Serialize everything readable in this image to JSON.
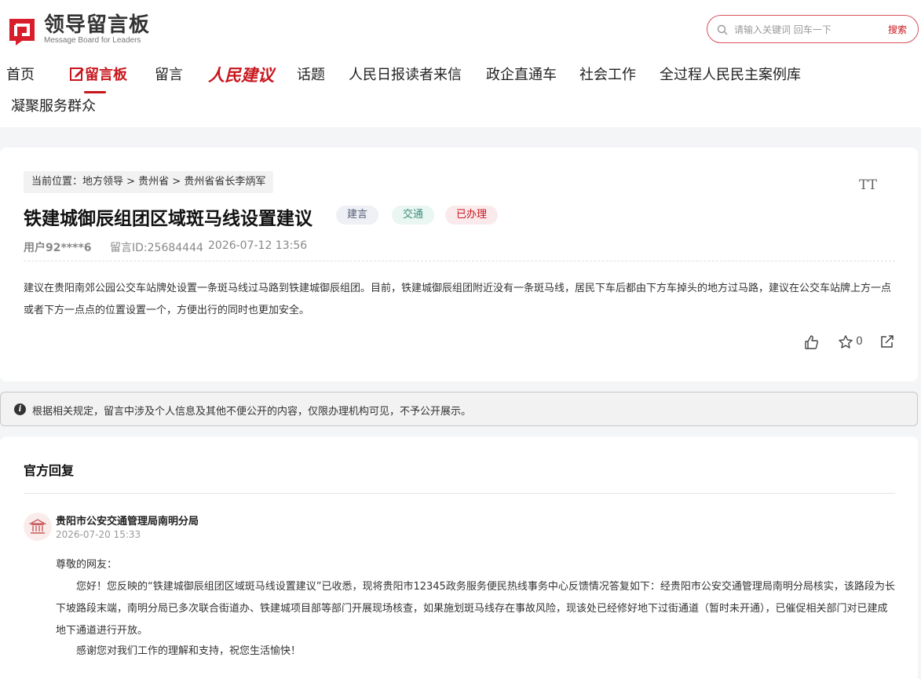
{
  "header": {
    "logo_cn": "领导留言板",
    "logo_en": "Message Board for Leaders",
    "search_placeholder": "请输入关键词 回车一下",
    "search_button": "搜索",
    "brand_color": "#c8161d"
  },
  "nav": {
    "home": "首页",
    "board": "留言板",
    "message": "留言",
    "peoples_suggestion": "人民建议",
    "topics": "话题",
    "letters": "人民日报读者来信",
    "business": "政企直通车",
    "social": "社会工作",
    "democracy": "全过程人民民主案例库",
    "serve": "凝聚服务群众"
  },
  "post": {
    "breadcrumb": "当前位置：地方领导 > 贵州省 > 贵州省省长李炳军",
    "font_toggle": "TT",
    "title": "铁建城御辰组团区域斑马线设置建议",
    "tags": [
      "建言",
      "交通",
      "已办理"
    ],
    "user": "用户92****6",
    "message_id": "留言ID:25684444",
    "time": "2026-07-12 13:56",
    "body": "建议在贵阳南郊公园公交车站牌处设置一条斑马线过马路到铁建城御辰组团。目前，铁建城御辰组团附近没有一条斑马线，居民下车后都由下方车掉头的地方过马路，建议在公交车站牌上方一点或者下方一点点的位置设置一个，方便出行的同时也更加安全。",
    "favorite_count": "0"
  },
  "notice": {
    "text": "根据相关规定，留言中涉及个人信息及其他不便公开的内容，仅限办理机构可见，不予公开展示。"
  },
  "reply": {
    "heading": "官方回复",
    "org": "贵阳市公安交通管理局南明分局",
    "time": "2026-07-20 15:33",
    "greeting": "尊敬的网友：",
    "body": "您好！您反映的“铁建城御辰组团区域斑马线设置建议”已收悉，现将贵阳市12345政务服务便民热线事务中心反馈情况答复如下：经贵阳市公安交通管理局南明分局核实，该路段为长下坡路段末端，南明分局已多次联合街道办、铁建城项目部等部门开展现场核查，如果施划斑马线存在事故风险，现该处已经修好地下过街通道（暂时未开通），已催促相关部门对已建成地下通道进行开放。",
    "thanks": "感谢您对我们工作的理解和支持，祝您生活愉快！"
  }
}
